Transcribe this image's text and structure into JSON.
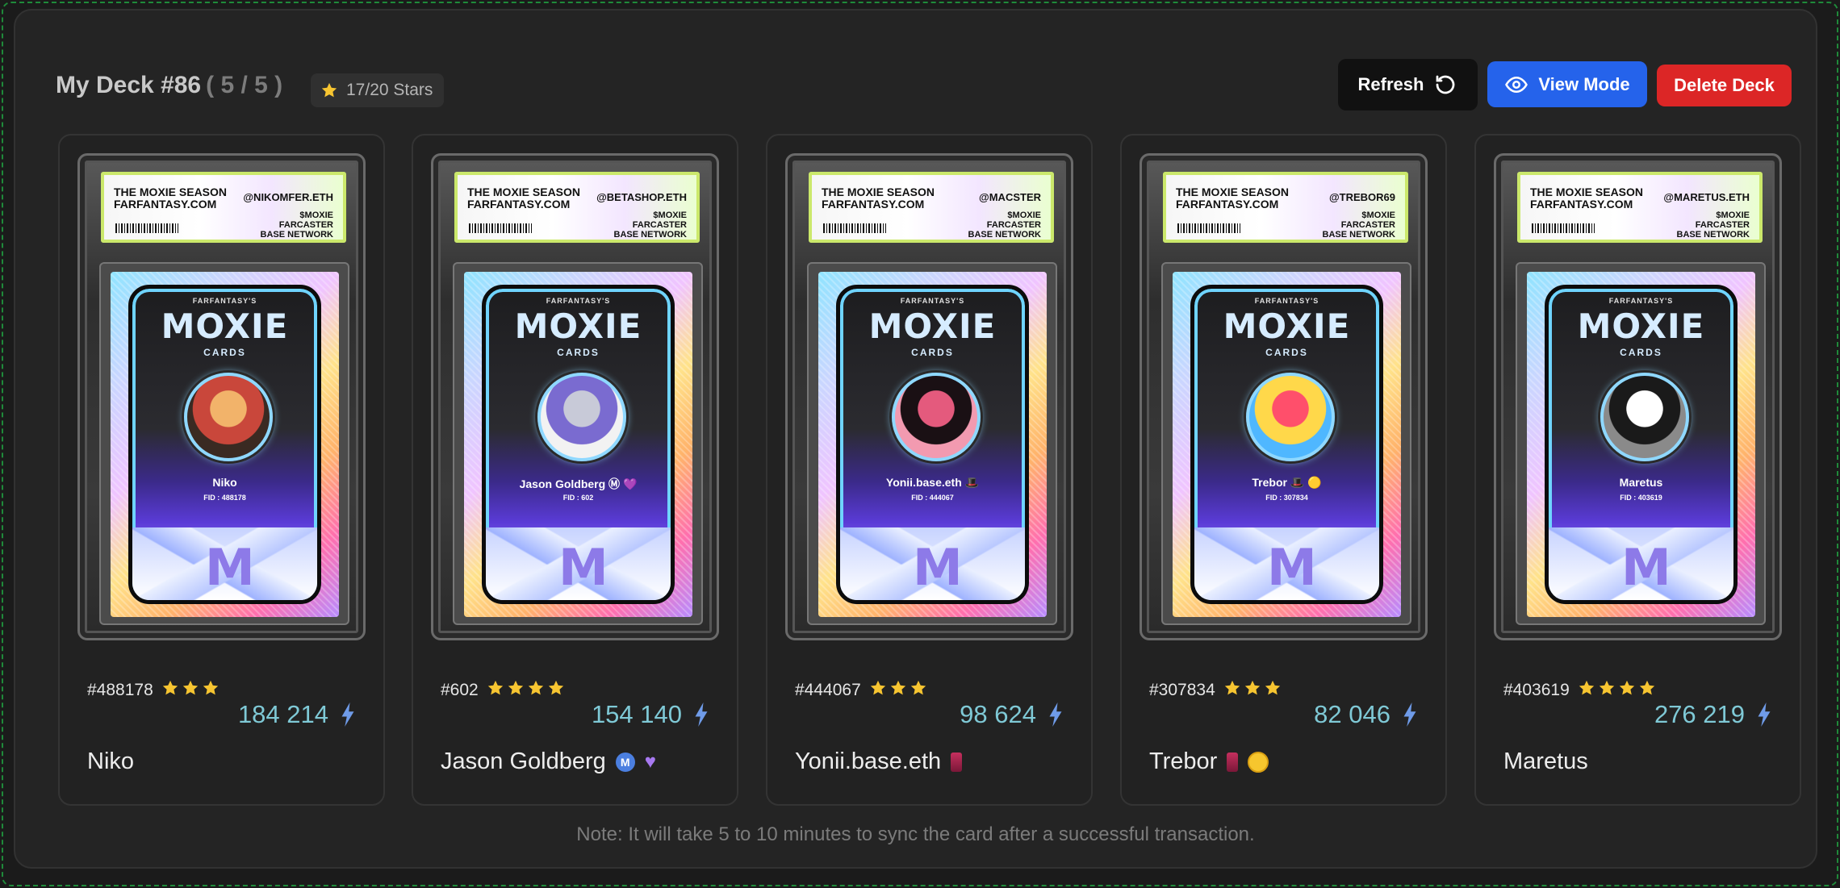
{
  "deck": {
    "title": "My Deck #86",
    "count": "( 5 / 5 )",
    "stars_badge": "17/20 Stars"
  },
  "buttons": {
    "refresh": "Refresh",
    "view_mode": "View Mode",
    "delete_deck": "Delete Deck"
  },
  "card_label_common": {
    "line1": "THE MOXIE SEASON",
    "line2": "FARFANTASY.COM",
    "meta1": "$MOXIE",
    "meta2": "FARCASTER",
    "meta3": "BASE NETWORK",
    "brand": "FARFANTASY'S",
    "moxie": "MOXIE",
    "cards_word": "CARDS",
    "big_m": "M"
  },
  "cards": [
    {
      "handle": "@NIKOMFER.ETH",
      "card_name": "Niko",
      "card_fid": "FID : 488178",
      "fid": "#488178",
      "stars": 3,
      "value": "184 214",
      "name": "Niko",
      "badges": [],
      "avatar_colors": [
        "#f2b36a",
        "#c9473b",
        "#3a2a22"
      ]
    },
    {
      "handle": "@BETASHOP.ETH",
      "card_name": "Jason Goldberg Ⓜ 💜",
      "card_fid": "FID : 602",
      "fid": "#602",
      "stars": 4,
      "value": "154 140",
      "name": "Jason Goldberg",
      "badges": [
        "m",
        "heart"
      ],
      "avatar_colors": [
        "#c8cad8",
        "#7a6bd0",
        "#f2f2f2"
      ]
    },
    {
      "handle": "@MACSTER",
      "card_name": "Yonii.base.eth 🎩",
      "card_fid": "FID : 444067",
      "fid": "#444067",
      "stars": 3,
      "value": "98 624",
      "name": "Yonii.base.eth",
      "badges": [
        "can"
      ],
      "avatar_colors": [
        "#e45a7d",
        "#1a1014",
        "#f29ab0"
      ]
    },
    {
      "handle": "@TREBOR69",
      "card_name": "Trebor 🎩 🟡",
      "card_fid": "FID : 307834",
      "fid": "#307834",
      "stars": 3,
      "value": "82 046",
      "name": "Trebor",
      "badges": [
        "can",
        "coin"
      ],
      "avatar_colors": [
        "#ff4f6b",
        "#ffd84a",
        "#4fb7ff"
      ]
    },
    {
      "handle": "@MARETUS.ETH",
      "card_name": "Maretus",
      "card_fid": "FID : 403619",
      "fid": "#403619",
      "stars": 4,
      "value": "276 219",
      "name": "Maretus",
      "badges": [],
      "avatar_colors": [
        "#ffffff",
        "#1a1a1a",
        "#8a8a8a"
      ]
    }
  ],
  "note": "Note: It will take 5 to 10 minutes to sync the card after a successful transaction.",
  "colors": {
    "accent_blue": "#2563eb",
    "danger_red": "#dc2626",
    "star": "#f7c531",
    "value_teal": "#7fc9d6",
    "bolt_blue": "#6f9be8"
  }
}
